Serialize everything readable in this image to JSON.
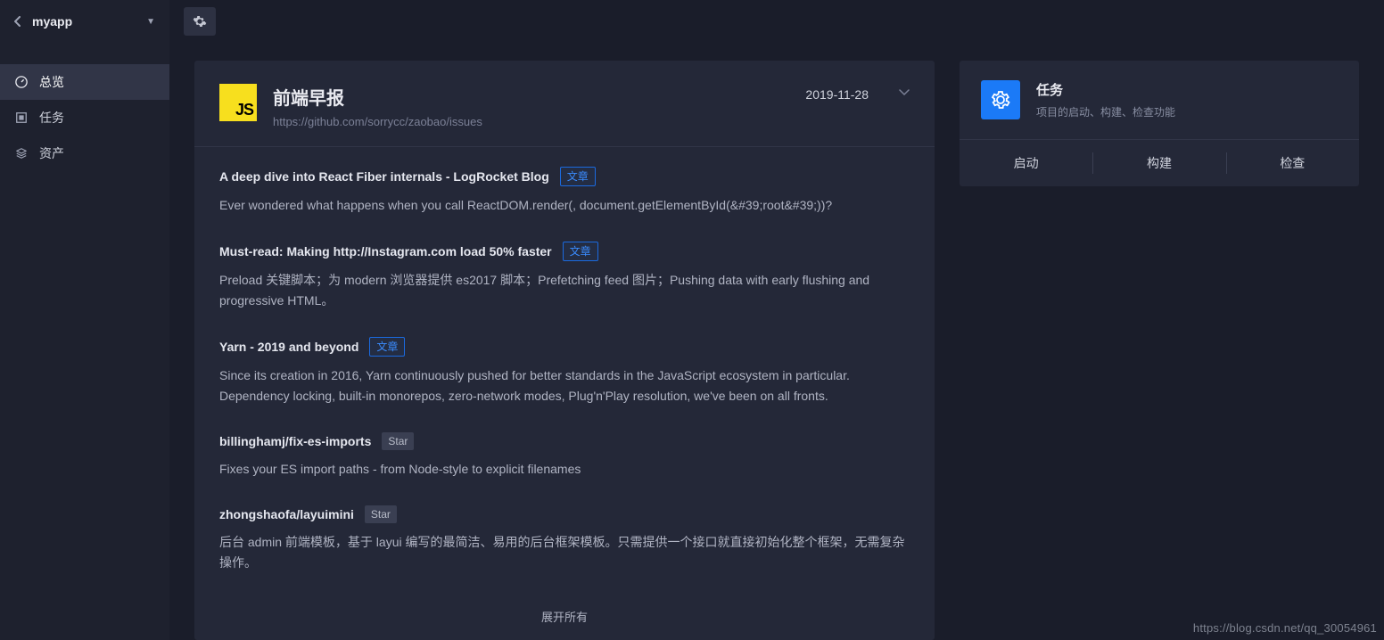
{
  "sidebar": {
    "app_name": "myapp",
    "items": [
      {
        "label": "总览",
        "icon": "dashboard"
      },
      {
        "label": "任务",
        "icon": "task"
      },
      {
        "label": "资产",
        "icon": "asset"
      }
    ]
  },
  "feed": {
    "badge": "JS",
    "title": "前端早报",
    "source_url": "https://github.com/sorrycc/zaobao/issues",
    "date": "2019-11-28",
    "tag_article": "文章",
    "tag_star": "Star",
    "show_all": "展开所有",
    "articles": [
      {
        "title": "A deep dive into React Fiber internals - LogRocket Blog",
        "tag": "article",
        "desc": "Ever wondered what happens when you call ReactDOM.render(, document.getElementById(&#39;root&#39;))?"
      },
      {
        "title": "Must-read: Making http://Instagram.com load 50% faster",
        "tag": "article",
        "desc": "Preload 关键脚本；为 modern 浏览器提供 es2017 脚本；Prefetching feed 图片；Pushing data with early flushing and progressive HTML。"
      },
      {
        "title": "Yarn - 2019 and beyond",
        "tag": "article",
        "desc": "Since its creation in 2016, Yarn continuously pushed for better standards in the JavaScript ecosystem in particular. Dependency locking, built-in monorepos, zero-network modes, Plug'n'Play resolution, we've been on all fronts."
      },
      {
        "title": "billinghamj/fix-es-imports",
        "tag": "star",
        "desc": "Fixes your ES import paths - from Node-style to explicit filenames"
      },
      {
        "title": "zhongshaofa/layuimini",
        "tag": "star",
        "desc": "后台 admin 前端模板，基于 layui 编写的最简洁、易用的后台框架模板。只需提供一个接口就直接初始化整个框架，无需复杂操作。"
      }
    ]
  },
  "tasks": {
    "title": "任务",
    "subtitle": "项目的启动、构建、检查功能",
    "actions": [
      "启动",
      "构建",
      "检查"
    ]
  },
  "watermark": "https://blog.csdn.net/qq_30054961"
}
